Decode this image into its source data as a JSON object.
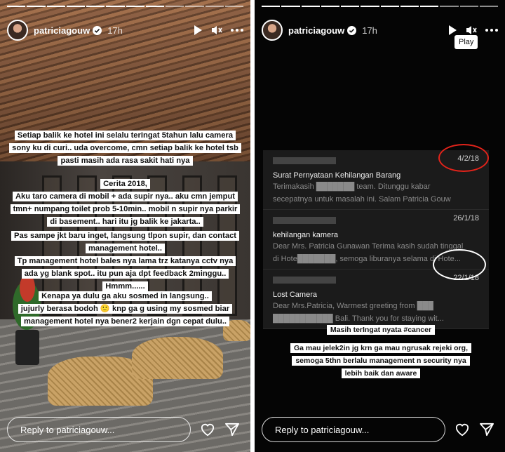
{
  "left_story": {
    "username": "patriciagouw",
    "time": "17h",
    "captions": [
      [
        "Setiap balik ke hotel ini selalu terIngat 5tahun lalu camera",
        "sony ku di curi.. uda overcome, cmn setiap balik ke hotel tsb",
        "pasti masih ada rasa sakit hati nya"
      ],
      [
        "Cerita 2018,",
        "Aku taro camera di mobil + ada supir nya.. aku cmn jemput",
        "tmn+ numpang toilet prob 5-10min.. mobil n supir nya parkir",
        "di basement.. hari itu jg balik ke jakarta.."
      ],
      [
        "Pas sampe jkt baru inget,  langsung tlpon supir, dan contact",
        "management hotel..",
        "Tp management hotel bales nya lama trz katanya cctv nya",
        "ada yg blank spot.. itu pun aja dpt feedback 2minggu..",
        "Hmmm......"
      ],
      [
        "Kenapa ya dulu ga aku sosmed in langsung..",
        "jujurly berasa bodoh 🙂 knp ga g using my sosmed biar",
        "management hotel nya bener2 kerjain dgn cepat dulu.."
      ]
    ],
    "reply_placeholder": "Reply to patriciagouw..."
  },
  "right_story": {
    "username": "patriciagouw",
    "time": "17h",
    "tooltip": "Play",
    "emails": [
      {
        "date": "4/2/18",
        "subject": "Surat Pernyataan Kehilangan Barang",
        "preview": [
          "Terimakasih ███████ team. Ditunggu kabar",
          "secepatnya untuk masalah ini. Salam Patricia Gouw"
        ]
      },
      {
        "date": "26/1/18",
        "subject": "kehilangan kamera",
        "preview": [
          "Dear Mrs. Patricia Gunawan Terima kasih sudah tinggal",
          "di Hote███████, semoga liburanya selama di Hote..."
        ]
      },
      {
        "date": "22/1/18",
        "subject": "Lost Camera",
        "preview": [
          "Dear Mrs.Patricia, Warmest greeting from ███",
          "███████████ Bali. Thank you for staying wit..."
        ]
      }
    ],
    "captions": [
      [
        "Masih terIngat nyata #cancer"
      ],
      [
        "Ga mau jelek2in jg krn ga mau ngrusak rejeki org,",
        "semoga 5thn berlalu management n security nya",
        "lebih baik dan aware"
      ]
    ],
    "reply_placeholder": "Reply to patriciagouw...",
    "highlight_color": "#e2231a"
  }
}
